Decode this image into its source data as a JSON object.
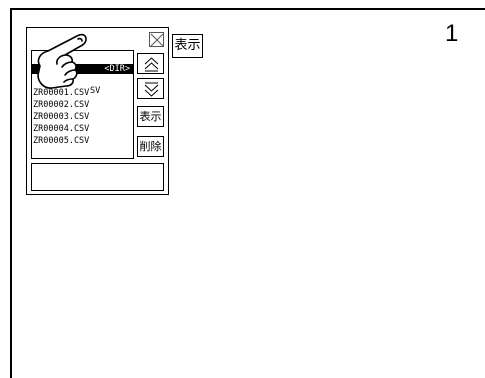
{
  "step": {
    "number": "1"
  },
  "file_manager": {
    "dir_label": "<DIR>",
    "partial_row_text": "SV",
    "files": [
      "ZR00001.CSV",
      "ZR00002.CSV",
      "ZR00003.CSV",
      "ZR00004.CSV",
      "ZR00005.CSV"
    ],
    "buttons": {
      "scroll_up": "double-up-arrow-icon",
      "scroll_down": "double-down-arrow-icon",
      "display_label": "表示",
      "delete_label": "削除"
    }
  },
  "outer": {
    "display_label": "表示"
  },
  "icons": [
    "close-icon",
    "pointing-hand-icon"
  ]
}
